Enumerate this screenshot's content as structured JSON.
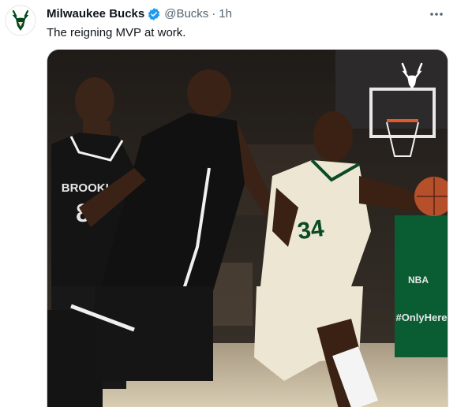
{
  "tweet": {
    "display_name": "Milwaukee Bucks",
    "handle": "@Bucks",
    "separator": "·",
    "time": "1h",
    "text": "The reigning MVP at work."
  },
  "media": {
    "left_jersey_team": "BROOKLYN",
    "left_jersey_number": "8",
    "right_jersey_number": "34",
    "court_sign_1": "NBA",
    "court_sign_2": "#OnlyHere"
  },
  "colors": {
    "verified": "#1d9bf0",
    "bucks_green": "#00471b",
    "secondary_text": "#536471"
  },
  "icons": {
    "avatar": "bucks-logo-icon",
    "verified": "verified-badge-icon",
    "more": "more-options-icon",
    "watermark": "bucks-deer-watermark-icon"
  }
}
